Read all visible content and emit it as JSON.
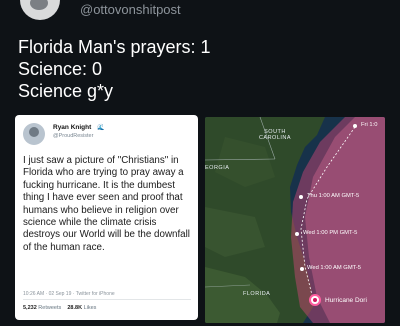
{
  "header": {
    "handle": "@ottovonshitpost"
  },
  "post": {
    "lines": [
      "Florida Man's prayers: 1",
      "Science: 0",
      "Science g*y"
    ]
  },
  "tweet": {
    "name": "Ryan Knight",
    "badge": "🌊",
    "handle": "@ProudResister",
    "body": "I just saw a picture of \"Christians\" in Florida who are trying to pray away a fucking hurricane. It is the dumbest thing I have ever seen and proof that humans who believe in religion over science while the climate crisis destroys our World will be the downfall of the human race.",
    "meta": "10:26 AM · 02 Sep 19 · Twitter for iPhone",
    "retweets": "5,232",
    "retweets_label": "Retweets",
    "likes": "28.8K",
    "likes_label": "Likes"
  },
  "map": {
    "labels": {
      "south_carolina": "SOUTH CAROLINA",
      "georgia": "EORGIA",
      "florida": "FLORIDA"
    },
    "forecast": [
      "Fri 1:0",
      "Thu 1:00 AM GMT-5",
      "Wed 1:00 PM GMT-5",
      "Wed 1:00 AM GMT-5"
    ],
    "storm_label": "Hurricane Dori",
    "colors": {
      "land": "#2f4a2a",
      "water": "#17324a",
      "cone": "#d8477a"
    }
  }
}
